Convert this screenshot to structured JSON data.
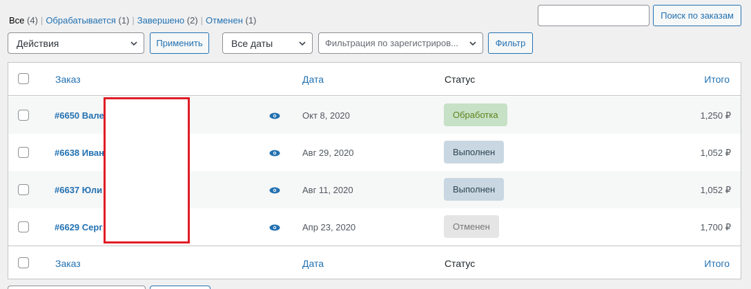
{
  "filters": {
    "all_label": "Все",
    "all_count": "(4)",
    "processing_label": "Обрабатывается",
    "processing_count": "(1)",
    "completed_label": "Завершено",
    "completed_count": "(2)",
    "cancelled_label": "Отменен",
    "cancelled_count": "(1)",
    "separator": "|"
  },
  "search": {
    "value": "",
    "button_label": "Поиск по заказам"
  },
  "toolbar": {
    "bulk_actions": "Действия",
    "apply_label": "Применить",
    "dates": "Все даты",
    "customer_filter_placeholder": "Фильтрация по зарегистриров...",
    "filter_label": "Фильтр"
  },
  "columns": {
    "order": "Заказ",
    "date": "Дата",
    "status": "Статус",
    "total": "Итого"
  },
  "orders": [
    {
      "label": "#6650 Вале",
      "date": "Окт 8, 2020",
      "status": "Обработка",
      "total": "1,250 ₽"
    },
    {
      "label": "#6638 Иван",
      "date": "Авг 29, 2020",
      "status": "Выполнен",
      "total": "1,052 ₽"
    },
    {
      "label": "#6637 Юли",
      "date": "Авг 11, 2020",
      "status": "Выполнен",
      "total": "1,052 ₽"
    },
    {
      "label": "#6629 Серг",
      "date": "Апр 23, 2020",
      "status": "Отменен",
      "total": "1,700 ₽"
    }
  ],
  "colors": {
    "accent": "#2271b1",
    "status_processing_bg": "#c6e1c6",
    "status_processing_fg": "#5b841b",
    "status_completed_bg": "#c8d7e1",
    "status_completed_fg": "#2e4453",
    "status_cancelled_bg": "#e5e5e5",
    "status_cancelled_fg": "#777777",
    "redaction_border": "#e01b24"
  },
  "icons": {
    "preview": "eye-icon",
    "dropdown": "chevron-down-icon"
  }
}
